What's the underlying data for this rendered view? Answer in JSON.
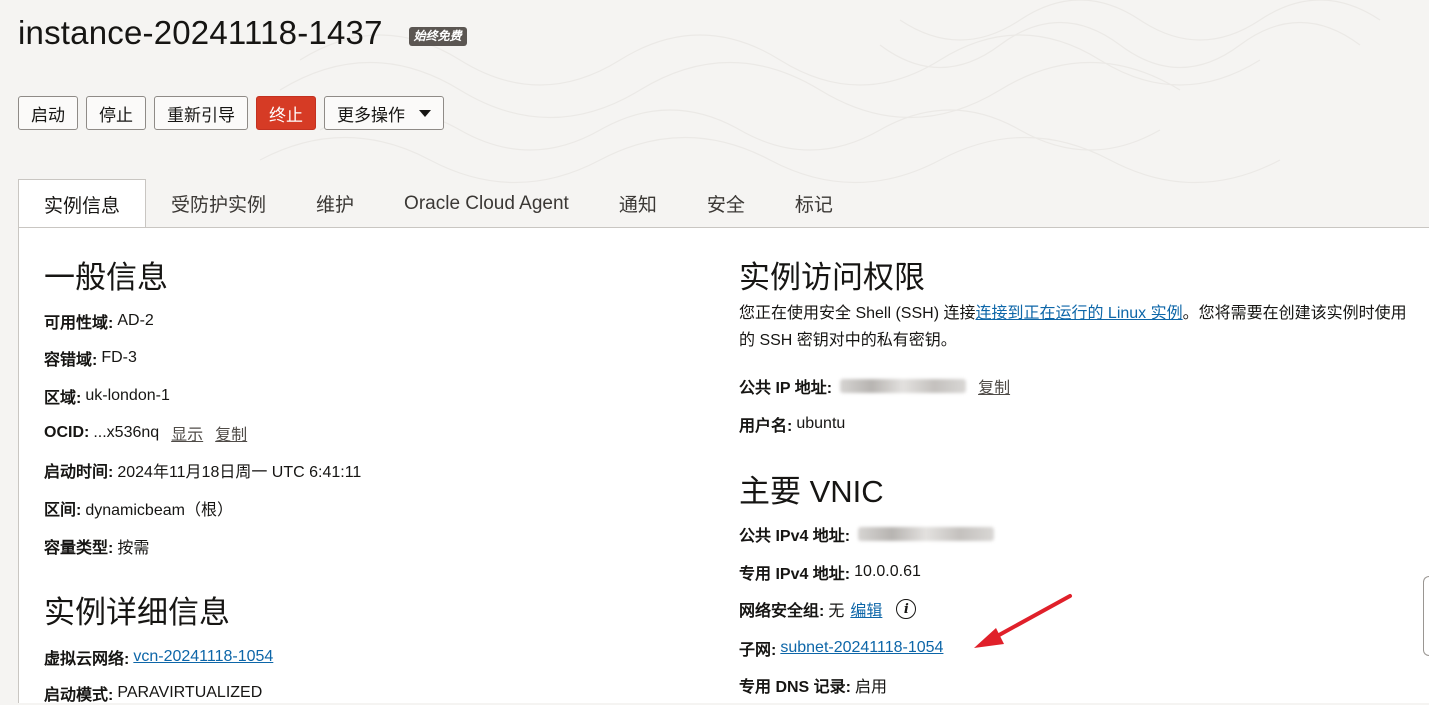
{
  "header": {
    "title": "instance-20241118-1437",
    "badge": "始终免费"
  },
  "actions": {
    "start": "启动",
    "stop": "停止",
    "reboot": "重新引导",
    "terminate": "终止",
    "more": "更多操作"
  },
  "tabs": [
    {
      "label": "实例信息",
      "active": true
    },
    {
      "label": "受防护实例"
    },
    {
      "label": "维护"
    },
    {
      "label": "Oracle Cloud Agent"
    },
    {
      "label": "通知"
    },
    {
      "label": "安全"
    },
    {
      "label": "标记"
    }
  ],
  "general": {
    "heading": "一般信息",
    "availability_domain": {
      "label": "可用性域:",
      "value": "AD-2"
    },
    "fault_domain": {
      "label": "容错域:",
      "value": "FD-3"
    },
    "region": {
      "label": "区域:",
      "value": "uk-london-1"
    },
    "ocid": {
      "label": "OCID:",
      "value": "...x536nq",
      "show": "显示",
      "copy": "复制"
    },
    "launch_time": {
      "label": "启动时间:",
      "value": "2024年11月18日周一 UTC 6:41:11"
    },
    "compartment": {
      "label": "区间:",
      "value": "dynamicbeam（根）"
    },
    "capacity_type": {
      "label": "容量类型:",
      "value": "按需"
    }
  },
  "details": {
    "heading": "实例详细信息",
    "vcn": {
      "label": "虚拟云网络:",
      "value": "vcn-20241118-1054"
    },
    "launch_mode": {
      "label": "启动模式:",
      "value": "PARAVIRTUALIZED"
    }
  },
  "access": {
    "heading": "实例访问权限",
    "text_before": "您正在使用安全 Shell (SSH) 连接",
    "link": "连接到正在运行的 Linux 实例",
    "text_after": "。您将需要在创建该实例时使用的 SSH 密钥对中的私有密钥。",
    "public_ip": {
      "label": "公共 IP 地址:",
      "copy": "复制"
    },
    "username": {
      "label": "用户名:",
      "value": "ubuntu"
    }
  },
  "vnic": {
    "heading": "主要 VNIC",
    "public_ipv4": {
      "label": "公共 IPv4 地址:"
    },
    "private_ipv4": {
      "label": "专用 IPv4 地址:",
      "value": "10.0.0.61"
    },
    "nsg": {
      "label": "网络安全组:",
      "value": "无",
      "edit": "编辑",
      "info": "i"
    },
    "subnet": {
      "label": "子网:",
      "value": "subnet-20241118-1054"
    },
    "private_dns": {
      "label": "专用 DNS 记录:",
      "value": "启用"
    }
  },
  "colors": {
    "accent_link": "#0d66a8",
    "danger": "#d63b25",
    "arrow": "#e0202a"
  }
}
